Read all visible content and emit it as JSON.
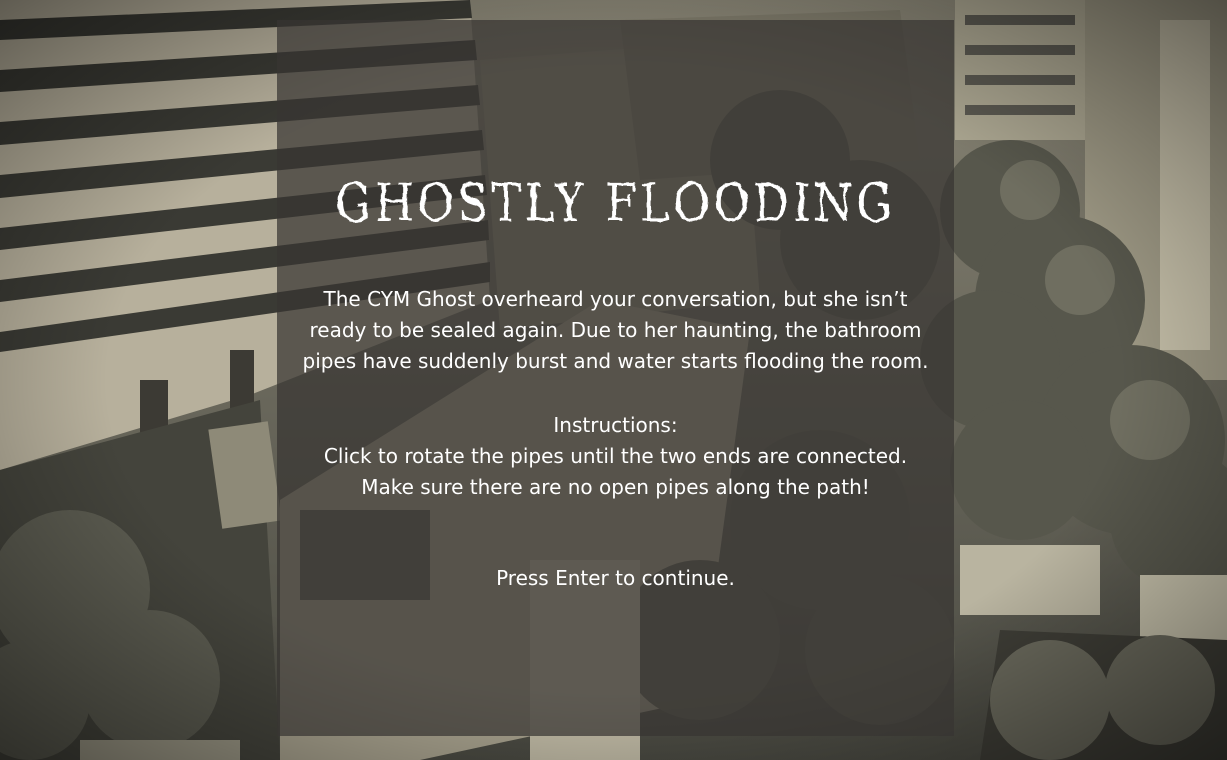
{
  "game": {
    "title": "Ghostly Flooding",
    "story_lines": [
      "The CYM Ghost overheard your conversation, but she isn’t",
      "ready to be sealed again. Due to her haunting, the bathroom",
      "pipes have suddenly burst and water starts flooding the room."
    ],
    "instructions_heading": "Instructions:",
    "instruction_lines": [
      "Click to rotate the pipes until the two ends are connected.",
      "Make sure there are no open pipes along the path!"
    ],
    "continue_prompt": "Press Enter to continue."
  },
  "colors": {
    "panel": "#373532",
    "text": "#ffffff",
    "background_tone": "#6e6a60"
  },
  "background": {
    "scene": "aerial campus photo, sepia/grayscale"
  }
}
